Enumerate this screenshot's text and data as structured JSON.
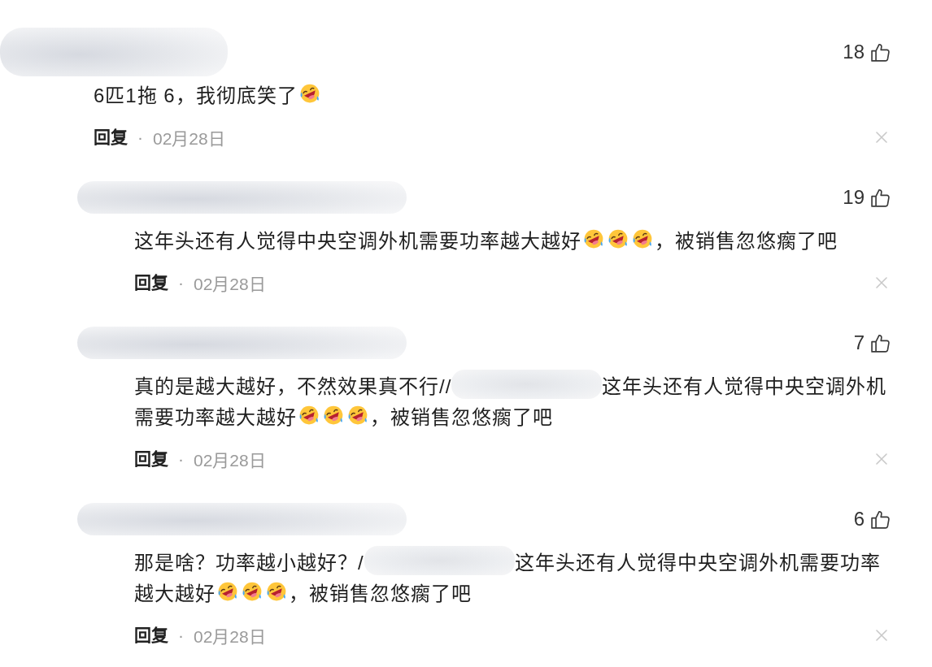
{
  "comments": [
    {
      "name_redacted": true,
      "likes": "18",
      "lines": [
        [
          {
            "kind": "text",
            "text": "6匹1拖 6，我彻底笑了"
          },
          {
            "kind": "emoji"
          }
        ]
      ],
      "reply_label": "回复",
      "separator": "·",
      "date": "02月28日",
      "closable": true,
      "replies": [
        {
          "name_redacted": true,
          "likes": "19",
          "lines": [
            [
              {
                "kind": "text",
                "text": "这年头还有人觉得中央空调外机需要功率越大越好"
              },
              {
                "kind": "emoji"
              },
              {
                "kind": "emoji"
              },
              {
                "kind": "emoji"
              },
              {
                "kind": "text",
                "text": "，被销售忽悠瘸了吧"
              }
            ]
          ],
          "reply_label": "回复",
          "separator": "·",
          "date": "02月28日",
          "closable": true
        },
        {
          "name_redacted": true,
          "likes": "7",
          "lines": [
            [
              {
                "kind": "text",
                "text": "真的是越大越好，不然效果真不行//"
              },
              {
                "kind": "redacted"
              },
              {
                "kind": "text",
                "text": "这年头还有人觉得中央空调外机"
              }
            ],
            [
              {
                "kind": "text",
                "text": "需要功率越大越好"
              },
              {
                "kind": "emoji"
              },
              {
                "kind": "emoji"
              },
              {
                "kind": "emoji"
              },
              {
                "kind": "text",
                "text": "，被销售忽悠瘸了吧"
              }
            ]
          ],
          "reply_label": "回复",
          "separator": "·",
          "date": "02月28日",
          "closable": true
        },
        {
          "name_redacted": true,
          "likes": "6",
          "lines": [
            [
              {
                "kind": "text",
                "text": "那是啥？功率越小越好？/"
              },
              {
                "kind": "redacted"
              },
              {
                "kind": "text",
                "text": "这年头还有人觉得中央空调外机需要功率"
              }
            ],
            [
              {
                "kind": "text",
                "text": "越大越好"
              },
              {
                "kind": "emoji"
              },
              {
                "kind": "emoji"
              },
              {
                "kind": "emoji"
              },
              {
                "kind": "text",
                "text": "，被销售忽悠瘸了吧"
              }
            ]
          ],
          "reply_label": "回复",
          "separator": "·",
          "date": "02月28日",
          "closable": true
        }
      ]
    }
  ]
}
